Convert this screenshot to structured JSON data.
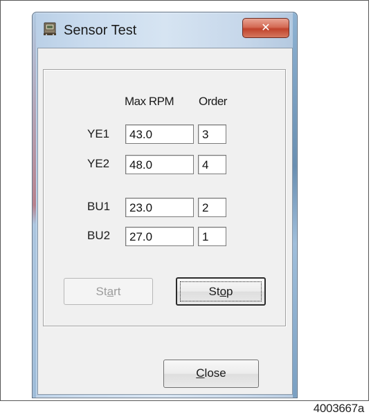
{
  "window": {
    "title": "Sensor Test",
    "close_glyph": "✕",
    "icon": "device-icon"
  },
  "table": {
    "headers": {
      "max_rpm": "Max RPM",
      "order": "Order"
    },
    "rows": [
      {
        "label": "YE1",
        "max_rpm": "43.0",
        "order": "3"
      },
      {
        "label": "YE2",
        "max_rpm": "48.0",
        "order": "4"
      },
      {
        "label": "BU1",
        "max_rpm": "23.0",
        "order": "2"
      },
      {
        "label": "BU2",
        "max_rpm": "27.0",
        "order": "1"
      }
    ]
  },
  "buttons": {
    "start_pre": "St",
    "start_accel": "a",
    "start_post": "rt",
    "stop_pre": "St",
    "stop_accel": "o",
    "stop_post": "p",
    "close_pre": "",
    "close_accel": "C",
    "close_post": "lose"
  },
  "figure_id": "4003667a"
}
